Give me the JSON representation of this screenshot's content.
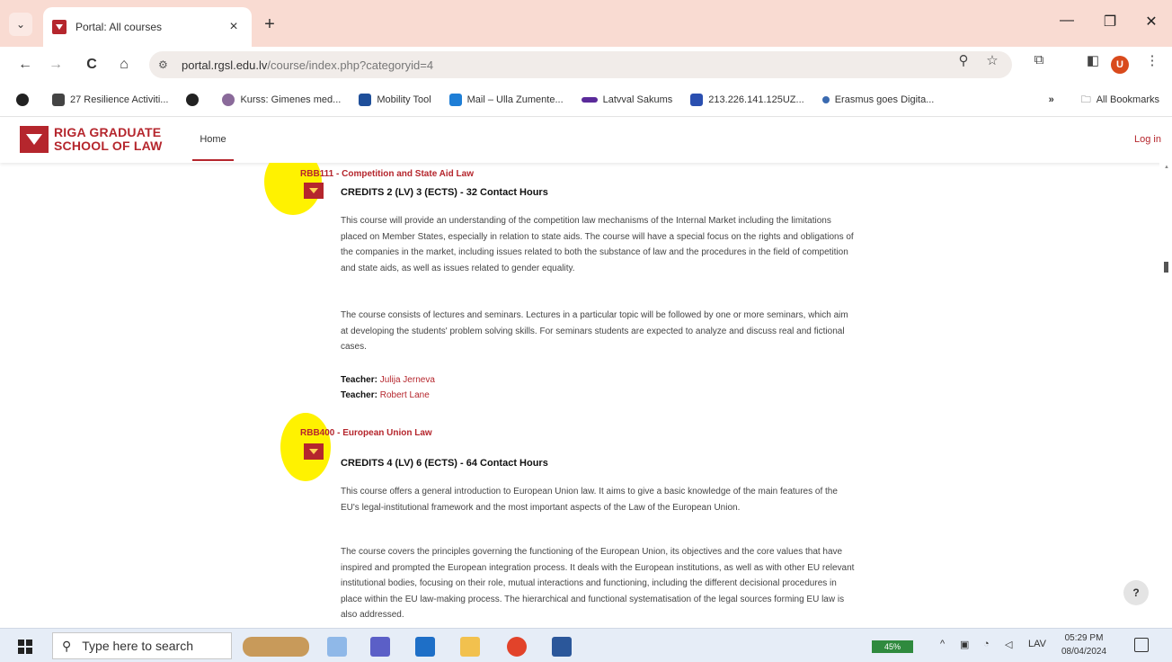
{
  "browser": {
    "tab_title": "Portal: All courses",
    "tab_close": "×",
    "new_tab": "+",
    "tab_menu": "⌄",
    "window": {
      "minimize": "—",
      "maximize": "❐",
      "close": "✕"
    },
    "nav": {
      "back": "←",
      "forward": "→",
      "reload": "C",
      "home": "⌂"
    },
    "url_host": "portal.rgsl.edu.lv",
    "url_path": "/course/index.php?categoryid=4",
    "omnibox_icons": {
      "zoom": "⚲",
      "star": "☆"
    },
    "toolbar_icons": {
      "extensions": "⧉",
      "sidepanel": "◧",
      "menu": "⋮"
    },
    "profile_initial": "U"
  },
  "bookmarks": {
    "items": [
      {
        "label": "27 Resilience Activiti...",
        "color": "#444444"
      },
      {
        "label": "",
        "color": "#222222"
      },
      {
        "label": "Kurss: Gimenes med...",
        "color": "#8a6a9a"
      },
      {
        "label": "Mobility Tool",
        "color": "#1f4f9a"
      },
      {
        "label": "Mail – Ulla Zumente...",
        "color": "#1e7ed6"
      },
      {
        "label": "Latvval Sakums",
        "color": "#5a2a9a"
      },
      {
        "label": "213.226.141.125UZ...",
        "color": "#2a4fb0"
      },
      {
        "label": "Erasmus goes Digita...",
        "color": "#3a6ab0"
      }
    ],
    "more": "»",
    "all_bookmarks": "All Bookmarks"
  },
  "site": {
    "logo_line1": "RIGA GRADUATE",
    "logo_line2": "SCHOOL OF LAW",
    "nav_home": "Home",
    "login": "Log in"
  },
  "courses": [
    {
      "code": "RBB111",
      "separator": " - ",
      "title": "Competition and State Aid Law",
      "credits": "CREDITS 2 (LV) 3 (ECTS) - 32 Contact Hours",
      "paragraphs": [
        "This course will provide an understanding of the competition law mechanisms of the Internal Market including the limitations placed on Member States, especially in relation to state aids. The course will have a special focus on the rights and obligations of the companies in the market, including issues related to both the substance of law and the procedures in the field of competition and state aids, as well as issues related to gender equality.",
        "The course consists of lectures and seminars. Lectures in a particular topic will be followed by one or more seminars, which aim at developing the students' problem solving skills. For seminars students are expected to analyze and discuss real and fictional cases."
      ],
      "teacher_label": "Teacher:",
      "teachers": [
        "Julija Jerneva",
        "Robert Lane"
      ]
    },
    {
      "code": "RBB400",
      "separator": " - ",
      "title": "European Union Law",
      "credits": "CREDITS 4 (LV) 6 (ECTS) - 64 Contact Hours",
      "paragraphs": [
        "This course offers a general introduction to European Union law. It aims to give a basic knowledge of the main features of the EU's legal-institutional framework and the most important aspects of the Law of the European Union.",
        "The course covers the principles governing the functioning of the European Union, its objectives and the core values that have inspired and prompted the European integration process. It deals with the European institutions, as well as with other EU relevant institutional bodies, focusing on their role, mutual interactions and functioning, including the different decisional procedures in place within the EU law-making process. The hierarchical and functional systematisation of the legal sources forming EU law is also addressed."
      ]
    }
  ],
  "help_button": "?",
  "taskbar": {
    "search_placeholder": "Type here to search",
    "battery": "45%",
    "tray_caret": "^",
    "language": "LAV",
    "time": "05:29 PM",
    "date": "08/04/2024"
  },
  "colors": {
    "brand": "#b5262d",
    "highlight": "#fff200",
    "tab_strip": "#f9dbd2"
  }
}
